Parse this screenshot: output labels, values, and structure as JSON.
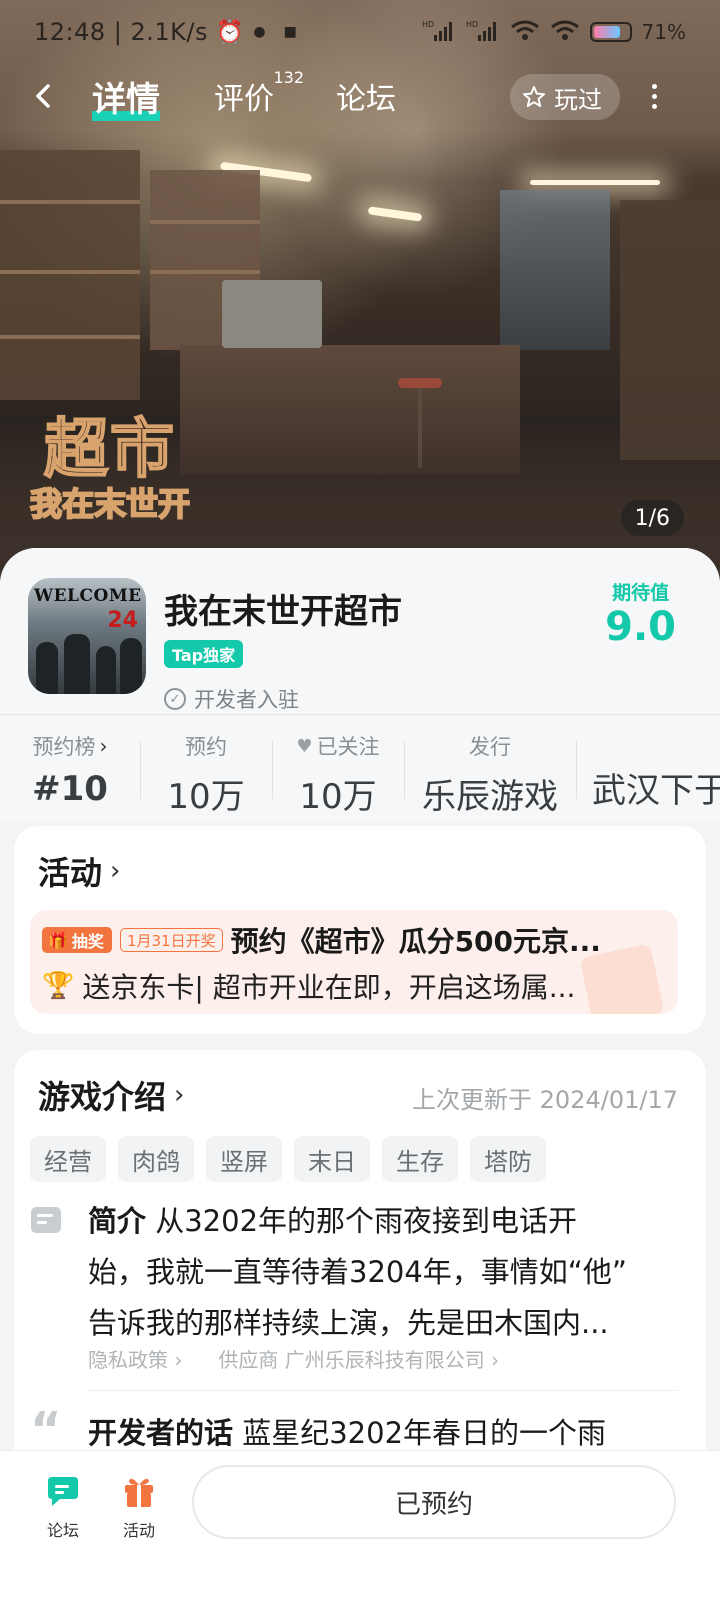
{
  "status_bar": {
    "time": "12:48",
    "network_speed": "2.1K/s",
    "battery_percent": "71%",
    "icons": [
      "alarm-icon",
      "notification-icon",
      "notification-icon",
      "signal-icon",
      "signal-icon",
      "wifi-icon",
      "wifi-icon",
      "battery-icon"
    ]
  },
  "nav": {
    "tabs": [
      {
        "label": "详情",
        "active": true
      },
      {
        "label": "评价",
        "badge": "132",
        "active": false
      },
      {
        "label": "论坛",
        "active": false
      }
    ],
    "played_label": "玩过"
  },
  "banner": {
    "logo_line1": "超市",
    "logo_line2": "我在末世开",
    "page_indicator": "1/6"
  },
  "game": {
    "icon_text": "WELCOME",
    "icon_number": "24",
    "title": "我在末世开超市",
    "tap_badge": "Tap独家",
    "developer_status": "开发者入驻",
    "expect_label": "期待值",
    "expect_value": "9.0"
  },
  "stats": [
    {
      "label": "预约榜",
      "value": "#10",
      "has_chevron": true
    },
    {
      "label": "预约",
      "value": "10万"
    },
    {
      "label": "已关注",
      "value": "10万",
      "has_heart": true
    },
    {
      "label": "发行",
      "value": "乐辰游戏"
    },
    {
      "label": "",
      "value": "武汉下于"
    }
  ],
  "activity": {
    "title": "活动",
    "item": {
      "tag": "抽奖",
      "date_tag": "1月31日开奖",
      "headline": "预约《超市》瓜分500元京...",
      "subline": "送京东卡| 超市开业在即，开启这场属..."
    }
  },
  "intro": {
    "title": "游戏介绍",
    "update_time": "上次更新于 2024/01/17",
    "tags": [
      "经营",
      "肉鸽",
      "竖屏",
      "末日",
      "生存",
      "塔防"
    ],
    "summary_label": "简介",
    "summary_line1": "从3202年的那个雨夜接到电话开",
    "summary_line2": "始，我就一直等待着3204年，事情如“他”",
    "summary_line3": "告诉我的那样持续上演，先是田木国内...",
    "privacy_link": "隐私政策",
    "supplier_label": "供应商",
    "supplier_name": "广州乐辰科技有限公司",
    "dev_words_label": "开发者的话",
    "dev_words_text": "蓝星纪3202年春日的一个雨"
  },
  "bottom_bar": {
    "forum_label": "论坛",
    "activity_label": "活动",
    "reserve_button": "已预约"
  },
  "colors": {
    "accent": "#14c9a9",
    "orange": "#f2743e",
    "hero_brown": "#7a6555"
  }
}
